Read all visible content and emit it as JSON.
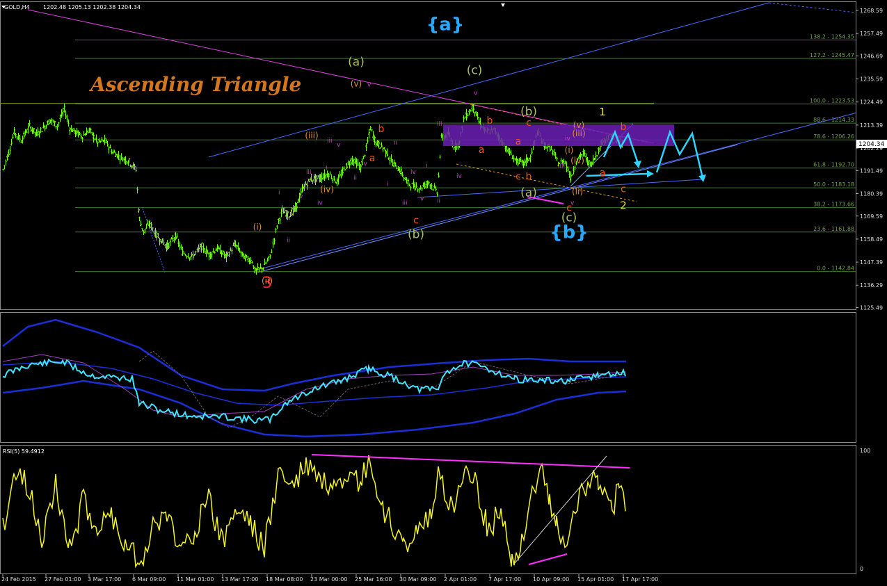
{
  "header": {
    "symbol": "GOLD,H4",
    "ohlc": "1202.48 1205.13 1202.38 1204.34",
    "rsi_label": "RSI(5) 59.4912"
  },
  "annotation_title": "Ascending Triangle",
  "current_price": "1204.34",
  "price_axis": [
    "1268.59",
    "1257.49",
    "1246.69",
    "1235.59",
    "1224.49",
    "1213.39",
    "1202.29",
    "1191.49",
    "1180.39",
    "1169.59",
    "1158.49",
    "1147.39",
    "1136.29",
    "1125.49"
  ],
  "rsi_axis": [
    "100",
    "0"
  ],
  "time_axis": [
    "24 Feb 2015",
    "27 Feb 01:00",
    "3 Mar 17:00",
    "6 Mar 09:00",
    "11 Mar 01:00",
    "13 Mar 17:00",
    "18 Mar 08:00",
    "23 Mar 00:00",
    "25 Mar 16:00",
    "30 Mar 09:00",
    "2 Apr 01:00",
    "7 Apr 17:00",
    "10 Apr 09:00",
    "15 Apr 01:00",
    "17 Apr 17:00"
  ],
  "fib_levels": [
    {
      "label": "138.2 - 1254.35",
      "price": 1254.35
    },
    {
      "label": "127.2 - 1245.47",
      "price": 1245.47
    },
    {
      "label": "100.0 - 1223.53",
      "price": 1223.53
    },
    {
      "label": "88.6 - 1214.33",
      "price": 1214.33
    },
    {
      "label": "78.6 - 1206.26",
      "price": 1206.26
    },
    {
      "label": "61.8 - 1192.70",
      "price": 1192.7
    },
    {
      "label": "50.0 - 1183.18",
      "price": 1183.18
    },
    {
      "label": "38.2 - 1173.66",
      "price": 1173.66
    },
    {
      "label": "23.6 - 1161.88",
      "price": 1161.88
    },
    {
      "label": "0.0 - 1142.84",
      "price": 1142.84
    }
  ],
  "wave_labels": [
    {
      "text": "{a}",
      "color": "#29a8ff",
      "size": 26,
      "time": "2 Apr",
      "price": 1259,
      "bold": true
    },
    {
      "text": "{b}",
      "color": "#29a8ff",
      "size": 26,
      "time": "13 Apr",
      "price": 1159,
      "bold": true
    },
    {
      "text": "3",
      "color": "#ff2020",
      "size": 22,
      "time": "18 Mar",
      "price": 1135
    },
    {
      "text": "(a)",
      "color": "#a8c060",
      "size": 17,
      "time": "25 Mar",
      "price": 1242
    },
    {
      "text": "(c)",
      "color": "#a8c060",
      "size": 17,
      "time": "3 Apr",
      "price": 1238
    },
    {
      "text": "(b)",
      "color": "#a8c060",
      "size": 17,
      "time": "9 Apr",
      "price": 1218
    },
    {
      "text": "(b)",
      "color": "#a8c060",
      "size": 17,
      "time": "31 Mar",
      "price": 1159
    },
    {
      "text": "(a)",
      "color": "#a8c060",
      "size": 17,
      "time": "9 Apr",
      "price": 1179
    },
    {
      "text": "(c)",
      "color": "#a8c060",
      "size": 17,
      "time": "13 Apr",
      "price": 1167
    },
    {
      "text": "1",
      "color": "#f0e020",
      "size": 15,
      "time": "16 Apr",
      "price": 1218
    },
    {
      "text": "2",
      "color": "#f0e020",
      "size": 15,
      "time": "17 Apr",
      "price": 1173
    },
    {
      "text": "b",
      "color": "#ff5010",
      "size": 14,
      "time": "27 Mar",
      "price": 1210
    },
    {
      "text": "a",
      "color": "#ff5010",
      "size": 14,
      "time": "26 Mar",
      "price": 1196
    },
    {
      "text": "c",
      "color": "#ff5010",
      "size": 14,
      "time": "31 Mar",
      "price": 1166
    },
    {
      "text": "a",
      "color": "#ff5010",
      "size": 14,
      "time": "4 Apr",
      "price": 1200
    },
    {
      "text": "b",
      "color": "#ff5010",
      "size": 14,
      "time": "7 Apr",
      "price": 1214
    },
    {
      "text": "c",
      "color": "#ff5010",
      "size": 14,
      "time": "9 Apr",
      "price": 1213
    },
    {
      "text": "a",
      "color": "#ff5010",
      "size": 14,
      "time": "8 Apr",
      "price": 1204
    },
    {
      "text": "c",
      "color": "#ff5010",
      "size": 14,
      "time": "8 Apr",
      "price": 1187
    },
    {
      "text": "b",
      "color": "#ff5010",
      "size": 14,
      "time": "9 Apr",
      "price": 1187
    },
    {
      "text": "c",
      "color": "#ff5010",
      "size": 14,
      "time": "13 Apr",
      "price": 1172
    },
    {
      "text": "b",
      "color": "#ff5010",
      "size": 14,
      "time": "17 Apr",
      "price": 1211
    },
    {
      "text": "a",
      "color": "#ff5010",
      "size": 14,
      "time": "16 Apr",
      "price": 1189
    },
    {
      "text": "c",
      "color": "#ff5010",
      "size": 14,
      "time": "17 Apr",
      "price": 1181
    },
    {
      "text": "(i)",
      "color": "#e09030",
      "size": 12,
      "time": "17 Mar",
      "price": 1163
    },
    {
      "text": "(ii)",
      "color": "#e09030",
      "size": 12,
      "time": "18 Mar",
      "price": 1137
    },
    {
      "text": "(iii)",
      "color": "#e09030",
      "size": 12,
      "time": "23 Mar",
      "price": 1207
    },
    {
      "text": "(iv)",
      "color": "#e09030",
      "size": 12,
      "time": "24 Mar",
      "price": 1181
    },
    {
      "text": "(v)",
      "color": "#e09030",
      "size": 12,
      "time": "25 Mar",
      "price": 1232
    },
    {
      "text": "(iii)",
      "color": "#e09030",
      "size": 12,
      "time": "15 Apr",
      "price": 1208
    },
    {
      "text": "(v)",
      "color": "#e09030",
      "size": 12,
      "time": "15 Apr",
      "price": 1212
    },
    {
      "text": "(i)",
      "color": "#e09030",
      "size": 12,
      "time": "13 Apr",
      "price": 1200
    },
    {
      "text": "(iv)",
      "color": "#e09030",
      "size": 12,
      "time": "14 Apr",
      "price": 1195
    },
    {
      "text": "(ii)",
      "color": "#e09030",
      "size": 12,
      "time": "14 Apr",
      "price": 1180
    }
  ]
}
